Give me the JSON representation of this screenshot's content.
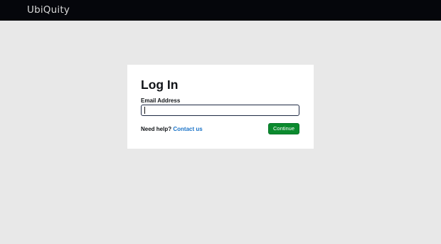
{
  "header": {
    "brand": "UbiQuity"
  },
  "login": {
    "title": "Log In",
    "email_label": "Email Address",
    "email_value": "",
    "help_text": "Need help?",
    "contact_link": "Contact us",
    "continue_label": "Continue"
  },
  "colors": {
    "topbar": "#05060b",
    "page_background": "#e8e8e8",
    "card": "#ffffff",
    "primary_button": "#0b8a2e",
    "link": "#1a73c8"
  }
}
